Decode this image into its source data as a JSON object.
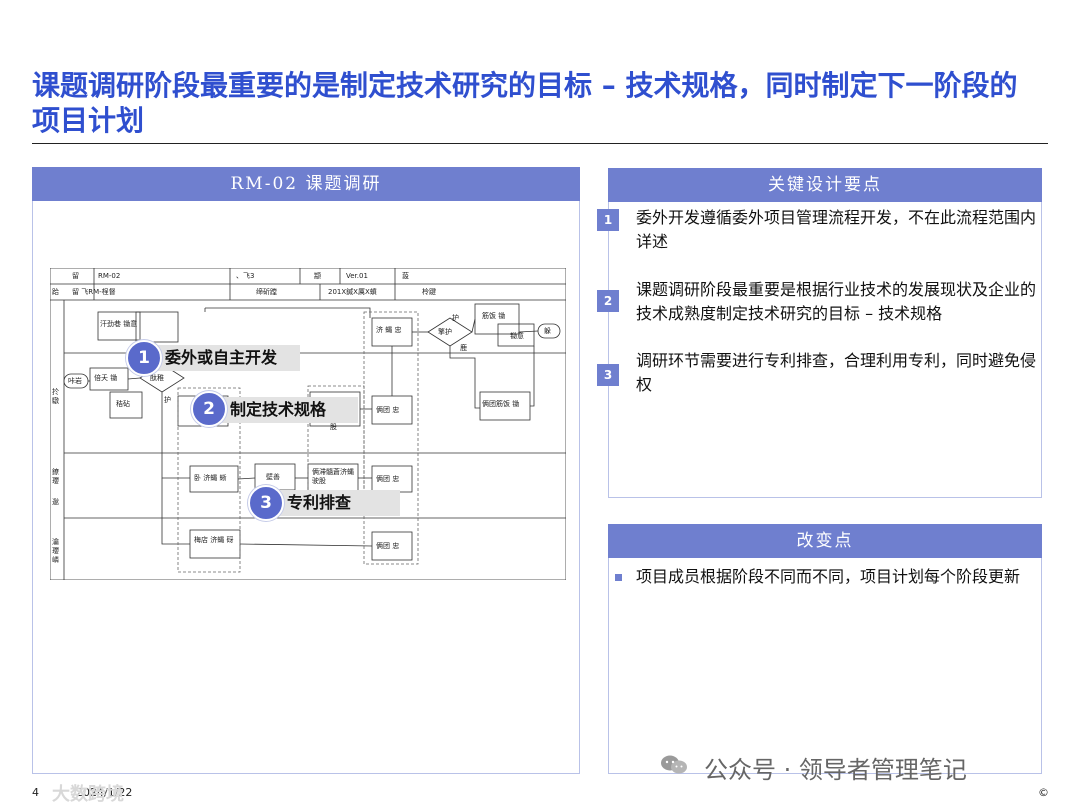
{
  "title": "课题调研阶段最重要的是制定技术研究的目标 – 技术规格，同时制定下一阶段的项目计划",
  "left_panel": {
    "header": "RM-02 课题调研",
    "flowchart": {
      "header_row1": [
        "留",
        "RM-02",
        "、飞3",
        "颛",
        "Ver.01",
        "蔎"
      ],
      "header_row2": [
        "跲",
        "留 飞RM-桯督",
        "缔斫蹚",
        "201X鍼X厲X蟦",
        "柃踺"
      ],
      "lanes": [
        "扵 驐",
        "鐐 瓔",
        "逖",
        "瀹瓔嶙"
      ],
      "boxes": {
        "a": "汗劲巷 锄意",
        "b": "倍夭 锄",
        "c": "秸砧",
        "d": "碃 巻",
        "e": "济 蝿 忠",
        "f": "卧 济蝿 蜥",
        "g": "壁善",
        "h": "俩滞髓蒼济蝿 驶股",
        "i": "梅店 济蝿 砑",
        "j": "俩团 忠",
        "k": "济 蝿 驶股",
        "l": "俩团 忠",
        "m": "俩团 忠",
        "n": "筋饭 锄",
        "o": "锄意",
        "p": "俩团筋饭 锄",
        "start": "咔岩",
        "end": "躲",
        "d1": "酞稚",
        "d2": "擎护",
        "y": "护",
        "n_label": "鹿"
      }
    },
    "callouts": [
      {
        "num": "1",
        "text": "委外或自主开发"
      },
      {
        "num": "2",
        "text": "制定技术规格"
      },
      {
        "num": "3",
        "text": "专利排查"
      }
    ]
  },
  "key_points": {
    "header": "关键设计要点",
    "items": [
      {
        "num": "1",
        "text": "委外开发遵循委外项目管理流程开发，不在此流程范围内详述"
      },
      {
        "num": "2",
        "text": "课题调研阶段最重要是根据行业技术的发展现状及企业的技术成熟度制定技术研究的目标 – 技术规格"
      },
      {
        "num": "3",
        "text": "调研环节需要进行专利排查，合理利用专利，同时避免侵权"
      }
    ]
  },
  "changes": {
    "header": "改变点",
    "items": [
      {
        "text": "项目成员根据阶段不同而不同，项目计划每个阶段更新"
      }
    ]
  },
  "footer": {
    "page": "4",
    "date": "2024/1/22",
    "copyright": "©",
    "watermark": "公众号 · 领导者管理笔记",
    "brand": "大数跨境"
  },
  "colors": {
    "title": "#2f4fcf",
    "accent": "#6f7fcf",
    "callout_circle": "#5a6acb"
  }
}
